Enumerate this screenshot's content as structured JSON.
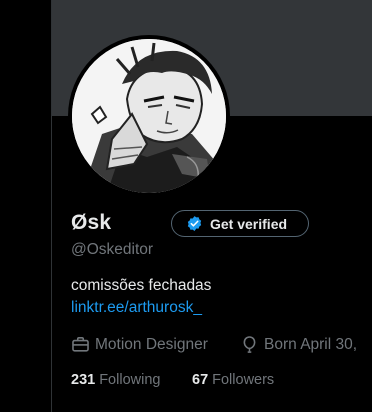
{
  "profile": {
    "display_name": "Øsk",
    "handle": "@Oskeditor",
    "verify_button": "Get verified",
    "bio": "comissões fechadas",
    "link": "linktr.ee/arthurosk_",
    "profession": "Motion Designer",
    "born": "Born April 30,"
  },
  "stats": {
    "following_count": "231",
    "following_label": "Following",
    "followers_count": "67",
    "followers_label": "Followers"
  },
  "icons": {
    "verify": "verified-badge-icon",
    "profession": "briefcase-icon",
    "born": "balloon-icon"
  },
  "colors": {
    "background": "#000000",
    "banner": "#333639",
    "primary_text": "#e7e9ea",
    "secondary_text": "#71767b",
    "link": "#1d9bf0",
    "verified_blue": "#1d9bf0"
  }
}
